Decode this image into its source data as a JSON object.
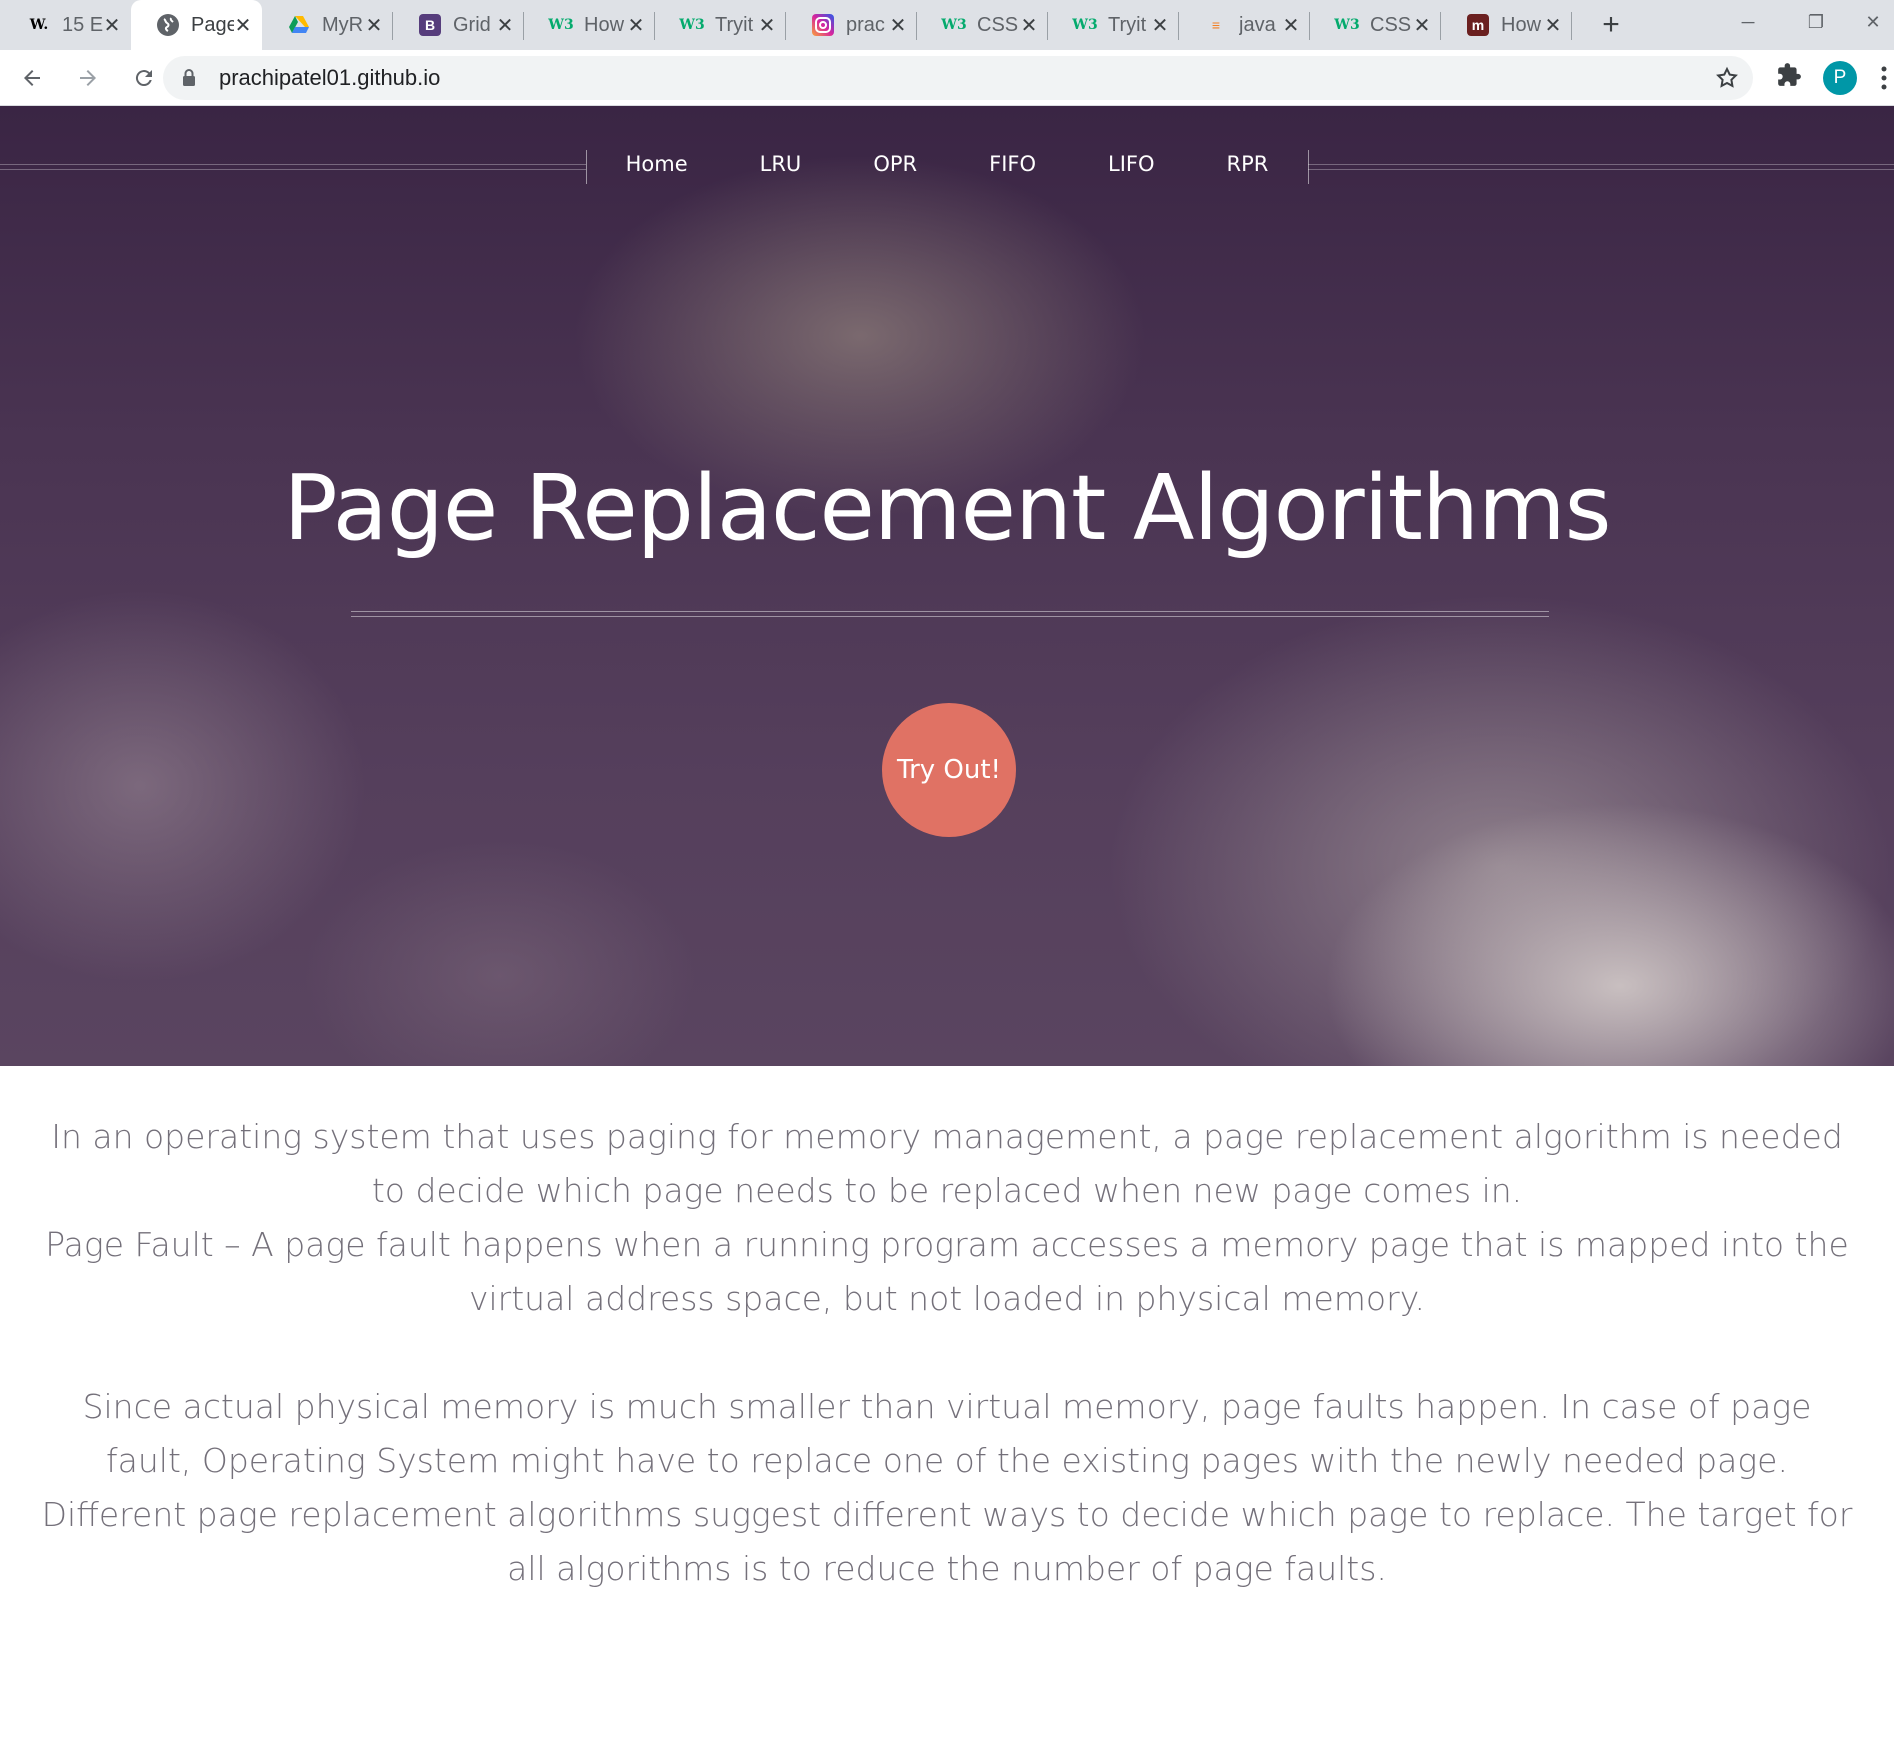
{
  "browser": {
    "tabs": [
      {
        "icon": "wikihow-icon",
        "glyph": "W.",
        "title": "15 E",
        "active": false
      },
      {
        "icon": "globe-icon",
        "glyph": "",
        "title": "Page",
        "active": true
      },
      {
        "icon": "google-drive-icon",
        "glyph": "",
        "title": "MyR",
        "active": false
      },
      {
        "icon": "bootstrap-icon",
        "glyph": "B",
        "title": "Grid",
        "active": false
      },
      {
        "icon": "w3schools-icon",
        "glyph": "W3",
        "title": "How",
        "active": false
      },
      {
        "icon": "w3schools-icon",
        "glyph": "W3",
        "title": "Tryit",
        "active": false
      },
      {
        "icon": "instagram-icon",
        "glyph": "",
        "title": "prac",
        "active": false
      },
      {
        "icon": "w3schools-icon",
        "glyph": "W3",
        "title": "CSS",
        "active": false
      },
      {
        "icon": "w3schools-icon",
        "glyph": "W3",
        "title": "Tryit",
        "active": false
      },
      {
        "icon": "stackoverflow-icon",
        "glyph": "≡",
        "title": "java",
        "active": false
      },
      {
        "icon": "w3schools-icon",
        "glyph": "W3",
        "title": "CSS",
        "active": false
      },
      {
        "icon": "medium-icon",
        "glyph": "m",
        "title": "How",
        "active": false
      }
    ],
    "url": "prachipatel01.github.io",
    "profile_initial": "P"
  },
  "hero": {
    "nav": [
      "Home",
      "LRU",
      "OPR",
      "FIFO",
      "LIFO",
      "RPR"
    ],
    "title": "Page Replacement Algorithms",
    "button": "Try Out!"
  },
  "content": {
    "p1": "In an operating system that uses paging for memory management, a page replacement algorithm is needed to decide which page needs to be replaced when new page comes in.",
    "p2": "Page Fault – A page fault happens when a running program accesses a memory page that is mapped into the virtual address space, but not loaded in physical memory.",
    "p3": "Since actual physical memory is much smaller than virtual memory, page faults happen. In case of page fault, Operating System might have to replace one of the existing pages with the newly needed page. Different page replacement algorithms suggest different ways to decide which page to replace. The target for all algorithms is to reduce the number of page faults."
  },
  "colors": {
    "button_bg": "#e07264",
    "hero_base": "#4a3452",
    "body_text": "#74707a"
  }
}
